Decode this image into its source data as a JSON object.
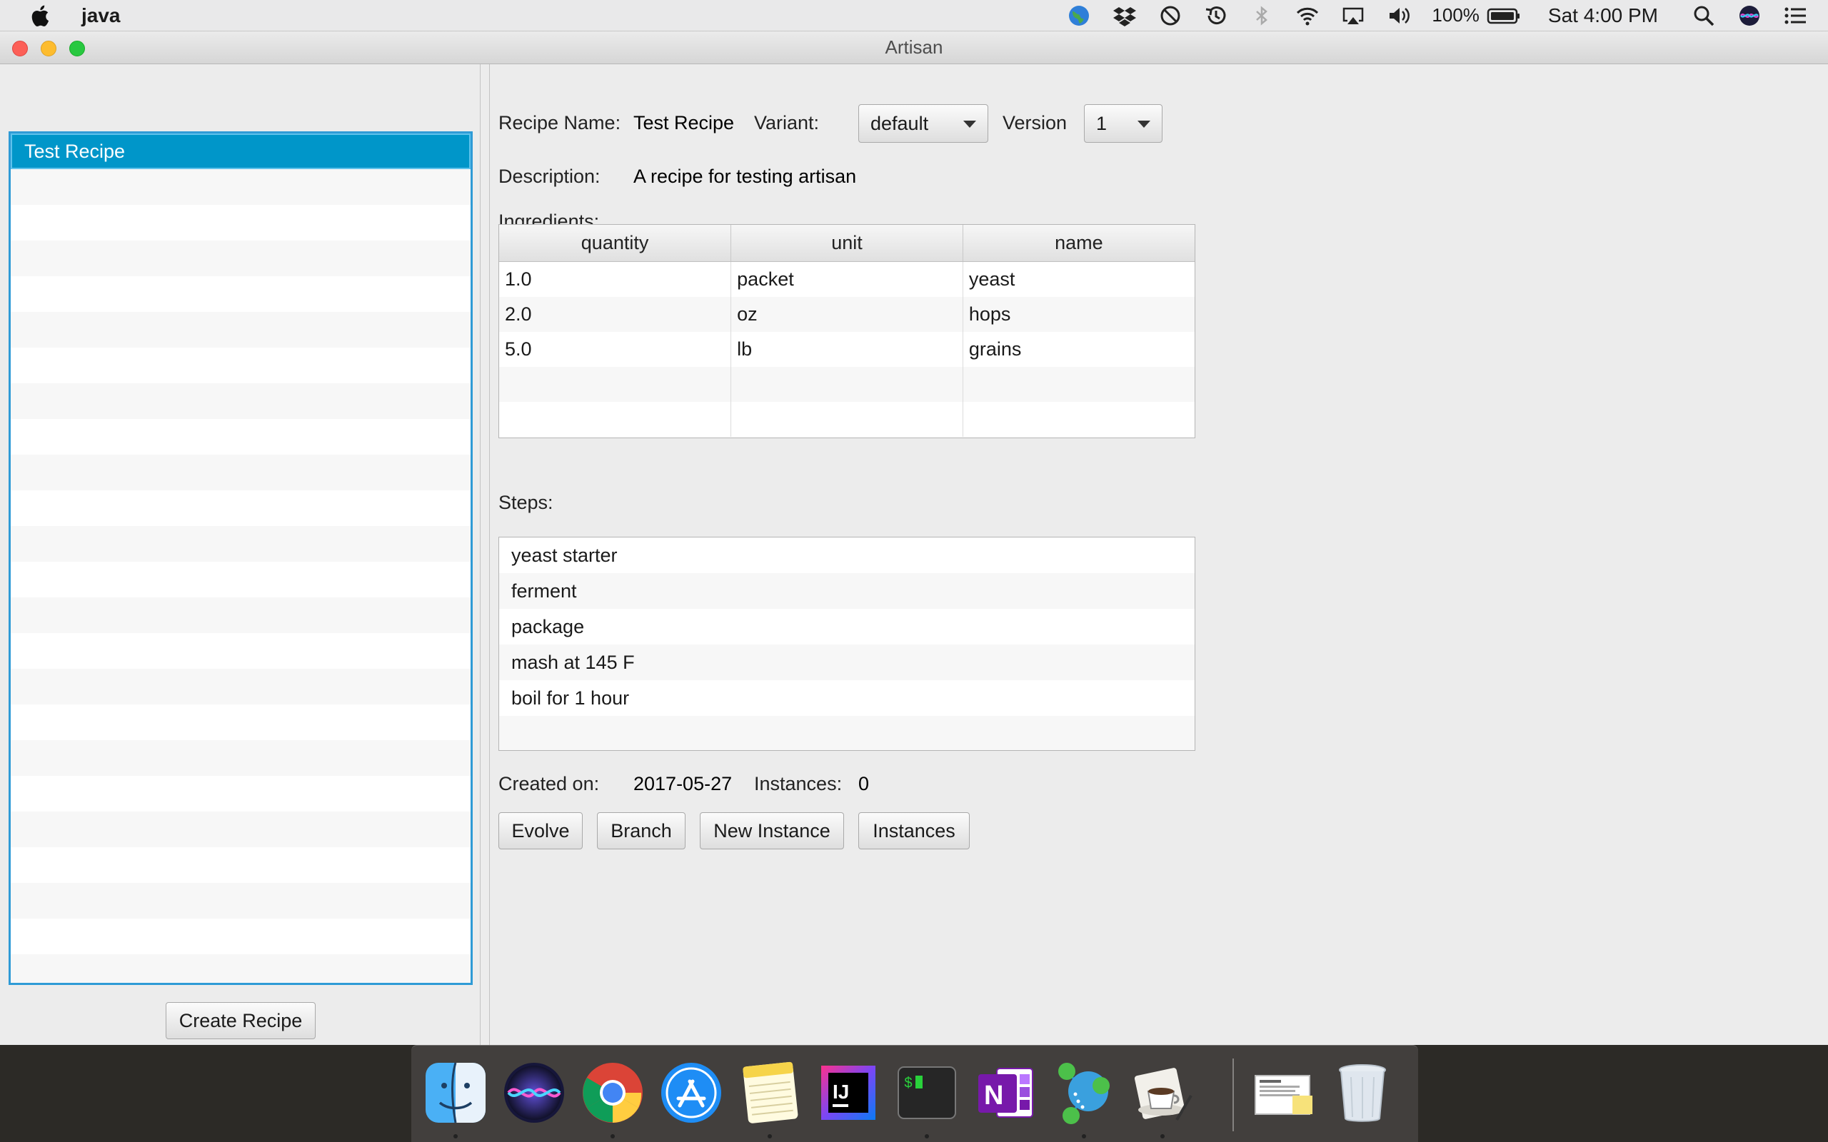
{
  "menubar": {
    "app_name": "java",
    "battery_percent": "100%",
    "clock": "Sat 4:00 PM",
    "icons": [
      "apple-icon",
      "globe-icon",
      "dropbox-icon",
      "do-not-disturb-icon",
      "time-machine-icon",
      "bluetooth-icon",
      "wifi-icon",
      "airplay-icon",
      "volume-icon",
      "battery-icon",
      "spotlight-icon",
      "siri-icon",
      "notification-center-icon"
    ]
  },
  "window": {
    "title": "Artisan",
    "colors": {
      "selection": "#0096c9",
      "focus_ring": "#2f9bd6"
    }
  },
  "recipes": {
    "items": [
      "Test Recipe"
    ],
    "selected": "Test Recipe",
    "create_button": "Create Recipe"
  },
  "detail": {
    "recipe_name_label": "Recipe Name:",
    "recipe_name": "Test Recipe",
    "variant_label": "Variant:",
    "variant_value": "default",
    "version_label": "Version",
    "version_value": "1",
    "description_label": "Description:",
    "description": "A recipe for testing artisan",
    "ingredients_label": "Ingredients:",
    "ingredients": {
      "columns": [
        "quantity",
        "unit",
        "name"
      ],
      "rows": [
        [
          "1.0",
          "packet",
          "yeast"
        ],
        [
          "2.0",
          "oz",
          "hops"
        ],
        [
          "5.0",
          "lb",
          "grains"
        ]
      ]
    },
    "steps_label": "Steps:",
    "steps": [
      "yeast starter",
      "ferment",
      "package",
      "mash at 145 F",
      "boil for 1 hour"
    ],
    "created_label": "Created on:",
    "created_value": "2017-05-27",
    "instances_label": "Instances:",
    "instances_value": "0",
    "buttons": {
      "evolve": "Evolve",
      "branch": "Branch",
      "new_instance": "New Instance",
      "instances": "Instances"
    }
  },
  "dock": {
    "apps": [
      "finder-icon",
      "siri-icon",
      "chrome-icon",
      "app-store-icon",
      "notes-icon",
      "intellij-icon",
      "terminal-icon",
      "onenote-icon",
      "neo4j-icon",
      "java-coffee-icon",
      "documents-stack-icon",
      "trash-icon"
    ]
  }
}
